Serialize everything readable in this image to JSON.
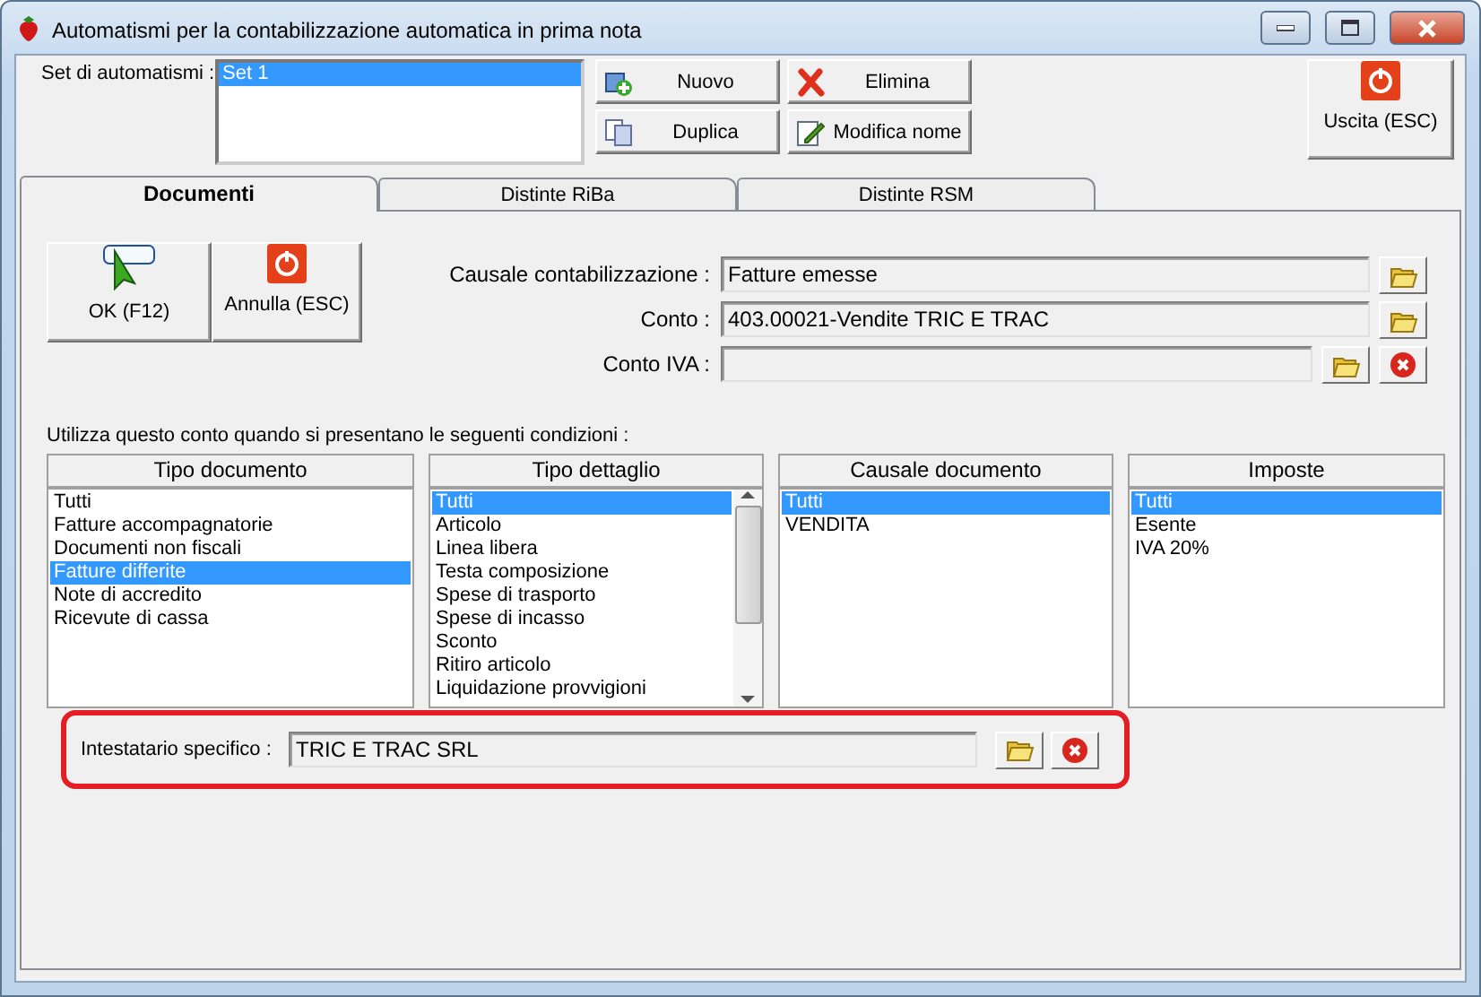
{
  "window": {
    "title": "Automatismi per la contabilizzazione automatica in prima nota"
  },
  "sets": {
    "label": "Set di automatismi :",
    "items": [
      {
        "label": "Set 1",
        "selected": true
      }
    ]
  },
  "set_buttons": [
    {
      "kind": "new",
      "label": "Nuovo"
    },
    {
      "kind": "delete",
      "label": "Elimina"
    },
    {
      "kind": "duplicate",
      "label": "Duplica"
    },
    {
      "kind": "rename",
      "label": "Modifica nome"
    }
  ],
  "exit_button": {
    "kind": "power",
    "label": "Uscita (ESC)"
  },
  "tabs": [
    {
      "label": "Documenti",
      "selected": true
    },
    {
      "label": "Distinte RiBa",
      "selected": false
    },
    {
      "label": "Distinte RSM",
      "selected": false
    }
  ],
  "action_buttons": [
    {
      "kind": "ok",
      "label": "OK (F12)"
    },
    {
      "kind": "power",
      "label": "Annulla (ESC)"
    }
  ],
  "fields": [
    {
      "label": "Causale contabilizzazione :",
      "value": "Fatture emesse",
      "buttons": [
        {
          "kind": "browse"
        }
      ]
    },
    {
      "label": "Conto :",
      "value": "403.00021-Vendite TRIC E TRAC",
      "buttons": [
        {
          "kind": "browse"
        }
      ]
    },
    {
      "label": "Conto IVA :",
      "buttons": [
        {
          "kind": "browse"
        },
        {
          "kind": "clear"
        }
      ]
    }
  ],
  "conditions": {
    "caption": "Utilizza questo conto quando si presentano le seguenti condizioni :",
    "lists": [
      {
        "header": "Tipo documento",
        "scrollbar": false,
        "items": [
          {
            "label": "Tutti",
            "selected": false
          },
          {
            "label": "Fatture accompagnatorie",
            "selected": false
          },
          {
            "label": "Documenti non fiscali",
            "selected": false
          },
          {
            "label": "Fatture differite",
            "selected": true
          },
          {
            "label": "Note di accredito",
            "selected": false
          },
          {
            "label": "Ricevute di cassa",
            "selected": false
          }
        ]
      },
      {
        "header": "Tipo dettaglio",
        "scrollbar": true,
        "items": [
          {
            "label": "Tutti",
            "selected": true
          },
          {
            "label": "Articolo",
            "selected": false
          },
          {
            "label": "Linea libera",
            "selected": false
          },
          {
            "label": "Testa composizione",
            "selected": false
          },
          {
            "label": "Spese di trasporto",
            "selected": false
          },
          {
            "label": "Spese di incasso",
            "selected": false
          },
          {
            "label": "Sconto",
            "selected": false
          },
          {
            "label": "Ritiro articolo",
            "selected": false
          },
          {
            "label": "Liquidazione provvigioni",
            "selected": false
          }
        ]
      },
      {
        "header": "Causale documento",
        "scrollbar": false,
        "items": [
          {
            "label": "Tutti",
            "selected": true
          },
          {
            "label": "VENDITA",
            "selected": false
          }
        ]
      },
      {
        "header": "Imposte",
        "scrollbar": false,
        "items": [
          {
            "label": "Tutti",
            "selected": true
          },
          {
            "label": "Esente",
            "selected": false
          },
          {
            "label": "IVA 20%",
            "selected": false
          }
        ]
      }
    ]
  },
  "specific_holder": {
    "label": "Intestatario specifico :",
    "value": "TRIC E TRAC SRL",
    "buttons": [
      {
        "kind": "browse"
      },
      {
        "kind": "clear"
      }
    ],
    "highlighted": true
  }
}
